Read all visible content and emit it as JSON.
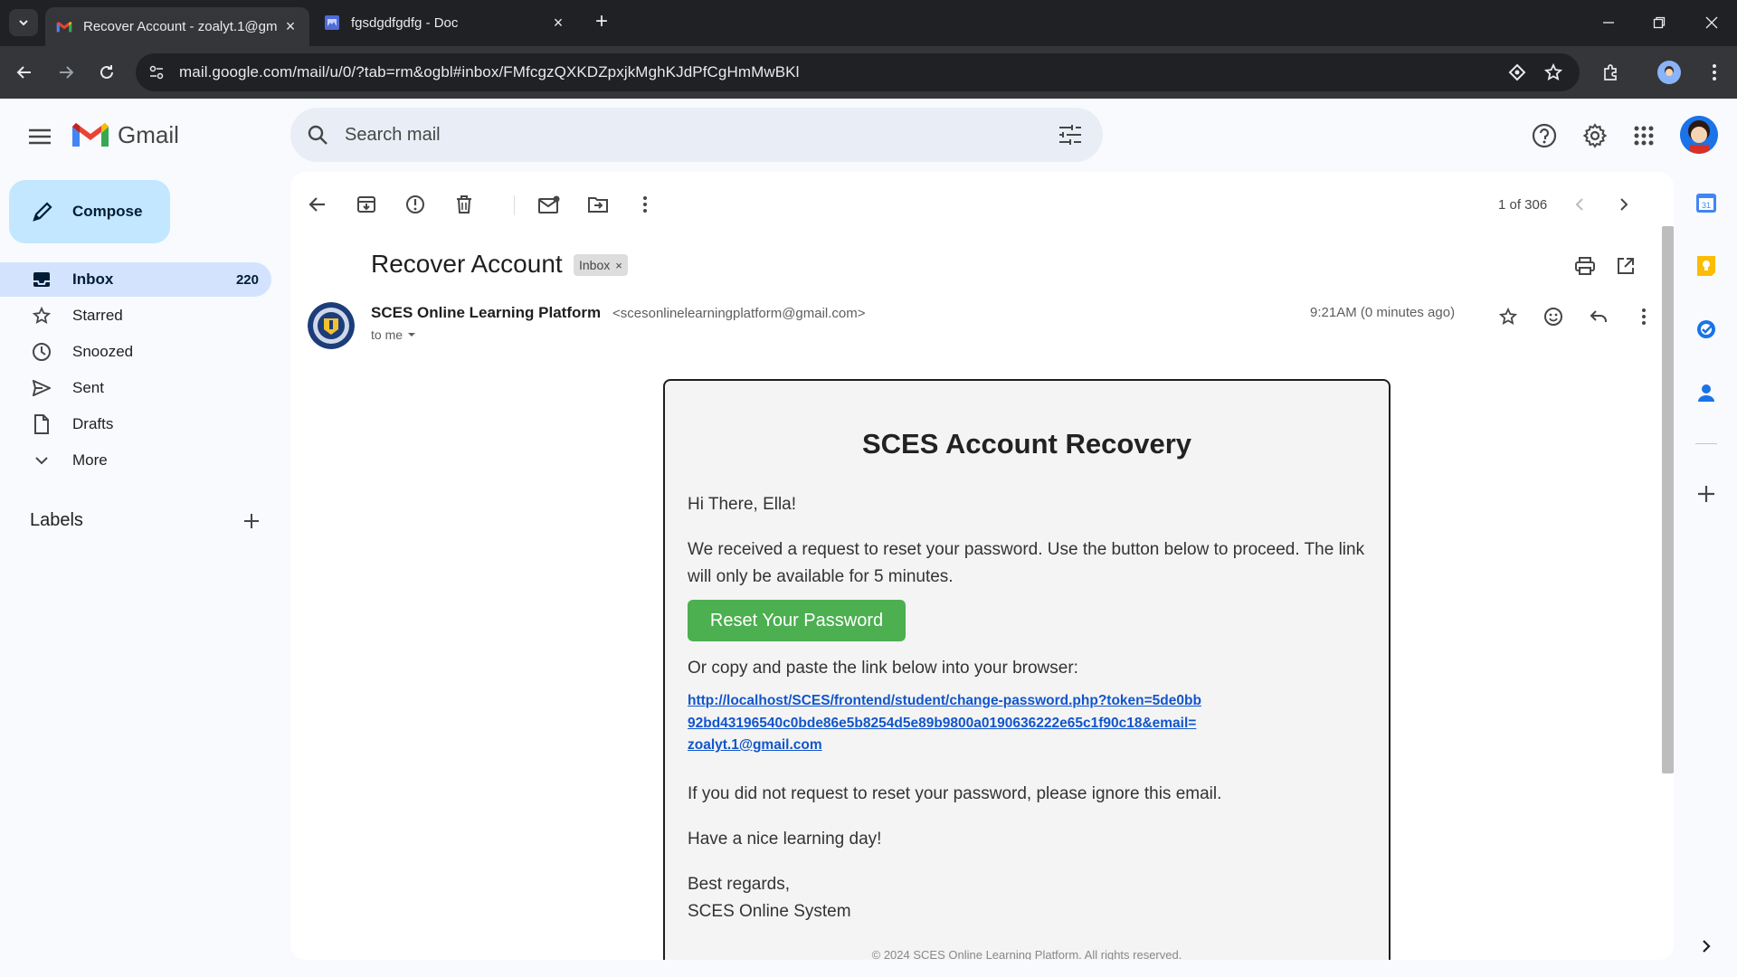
{
  "browser": {
    "tabs": [
      {
        "title": "Recover Account - zoalyt.1@gm",
        "active": true,
        "icon": "gmail-icon"
      },
      {
        "title": "fgsdgdfgdfg - Doc",
        "active": false,
        "icon": "docs-icon"
      }
    ],
    "url": "mail.google.com/mail/u/0/?tab=rm&ogbl#inbox/FMfcgzQXKDZpxjkMghKJdPfCgHmMwBKl"
  },
  "gmail": {
    "logo_text": "Gmail",
    "search_placeholder": "Search mail",
    "compose_label": "Compose",
    "nav": [
      {
        "label": "Inbox",
        "count": "220",
        "icon": "inbox-icon",
        "active": true
      },
      {
        "label": "Starred",
        "count": "",
        "icon": "star-icon",
        "active": false
      },
      {
        "label": "Snoozed",
        "count": "",
        "icon": "clock-icon",
        "active": false
      },
      {
        "label": "Sent",
        "count": "",
        "icon": "send-icon",
        "active": false
      },
      {
        "label": "Drafts",
        "count": "",
        "icon": "draft-icon",
        "active": false
      },
      {
        "label": "More",
        "count": "",
        "icon": "chevron-down-icon",
        "active": false
      }
    ],
    "labels_title": "Labels"
  },
  "message": {
    "pager": "1 of 306",
    "subject": "Recover Account",
    "label_chip": "Inbox",
    "sender_name": "SCES Online Learning Platform",
    "sender_email": "<scesonlinelearningplatform@gmail.com>",
    "recipient": "to me",
    "time": "9:21AM (0 minutes ago)"
  },
  "email_body": {
    "heading": "SCES Account Recovery",
    "greeting": "Hi There, Ella!",
    "intro": "We received a request to reset your password. Use the button below to proceed. The link will only be available for 5 minutes.",
    "button_label": "Reset Your Password",
    "copy_text": "Or copy and paste the link below into your browser:",
    "link_url": "http://localhost/SCES/frontend/student/change-password.php?token=5de0bb92bd43196540c0bde86e5b8254d5e89b9800a0190636222e65c1f90c18&email=zoalyt.1@gmail.com",
    "ignore_text": "If you did not request to reset your password, please ignore this email.",
    "closing": "Have a nice learning day!",
    "signoff_1": "Best regards,",
    "signoff_2": "SCES Online System",
    "footer": "© 2024 SCES Online Learning Platform. All rights reserved."
  },
  "colors": {
    "button_green": "#4caf50",
    "link_blue": "#1155cc",
    "active_nav": "#d3e3fd",
    "compose": "#c2e7ff"
  }
}
